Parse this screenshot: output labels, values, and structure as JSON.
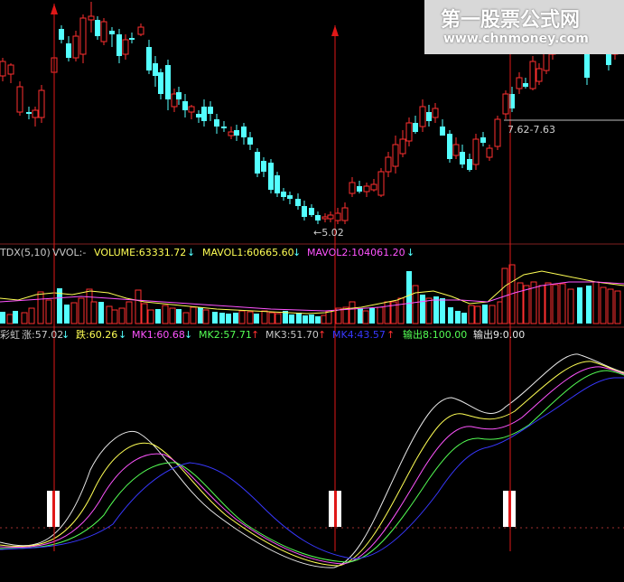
{
  "watermark": {
    "title": "第一股票公式网",
    "url": "www.chnmoney.com"
  },
  "price_panel": {
    "low_marker": "←5.02",
    "range_label": "7.62-7.63",
    "candles": [
      [
        3,
        84,
        68,
        90,
        64
      ],
      [
        12,
        82,
        72,
        92,
        70
      ],
      [
        22,
        124,
        96,
        128,
        90
      ],
      [
        32,
        124,
        124,
        132,
        118
      ],
      [
        39,
        130,
        122,
        140,
        118
      ],
      [
        46,
        130,
        100,
        136,
        94
      ],
      [
        60,
        80,
        64,
        86,
        56
      ],
      [
        68,
        32,
        44,
        48,
        28
      ],
      [
        76,
        48,
        64,
        68,
        40
      ],
      [
        84,
        64,
        40,
        68,
        34
      ],
      [
        92,
        60,
        20,
        70,
        16
      ],
      [
        101,
        22,
        18,
        36,
        2
      ],
      [
        108,
        22,
        40,
        44,
        18
      ],
      [
        115,
        46,
        24,
        50,
        20
      ],
      [
        124,
        34,
        38,
        52,
        30
      ],
      [
        132,
        38,
        62,
        70,
        32
      ],
      [
        139,
        60,
        44,
        66,
        38
      ],
      [
        146,
        42,
        42,
        48,
        36
      ],
      [
        156,
        38,
        30,
        40,
        26
      ],
      [
        165,
        52,
        78,
        82,
        44
      ],
      [
        172,
        70,
        84,
        96,
        62
      ],
      [
        178,
        80,
        104,
        110,
        76
      ],
      [
        186,
        72,
        110,
        122,
        66
      ],
      [
        193,
        118,
        104,
        124,
        98
      ],
      [
        198,
        102,
        110,
        116,
        96
      ],
      [
        205,
        112,
        122,
        130,
        104
      ],
      [
        212,
        124,
        118,
        132,
        116
      ],
      [
        220,
        126,
        130,
        136,
        122
      ],
      [
        226,
        118,
        134,
        140,
        110
      ],
      [
        233,
        118,
        126,
        134,
        112
      ],
      [
        240,
        132,
        140,
        148,
        126
      ],
      [
        248,
        140,
        140,
        146,
        134
      ],
      [
        256,
        150,
        146,
        154,
        140
      ],
      [
        262,
        144,
        150,
        156,
        138
      ],
      [
        270,
        140,
        152,
        160,
        136
      ],
      [
        277,
        152,
        160,
        166,
        146
      ],
      [
        285,
        168,
        192,
        196,
        164
      ],
      [
        292,
        178,
        190,
        196,
        174
      ],
      [
        300,
        180,
        210,
        214,
        176
      ],
      [
        307,
        194,
        214,
        218,
        190
      ],
      [
        314,
        212,
        218,
        222,
        208
      ],
      [
        321,
        216,
        220,
        226,
        212
      ],
      [
        330,
        220,
        228,
        232,
        214
      ],
      [
        337,
        228,
        240,
        244,
        222
      ],
      [
        345,
        230,
        238,
        240,
        226
      ],
      [
        352,
        238,
        244,
        248,
        234
      ],
      [
        360,
        242,
        240,
        246,
        236
      ],
      [
        366,
        242,
        238,
        246,
        234
      ],
      [
        374,
        244,
        236,
        248,
        230
      ],
      [
        382,
        244,
        230,
        248,
        224
      ],
      [
        390,
        214,
        202,
        218,
        196
      ],
      [
        398,
        206,
        212,
        214,
        200
      ],
      [
        406,
        212,
        206,
        218,
        202
      ],
      [
        414,
        210,
        204,
        212,
        198
      ],
      [
        422,
        216,
        190,
        218,
        186
      ],
      [
        430,
        190,
        174,
        196,
        168
      ],
      [
        438,
        184,
        160,
        192,
        150
      ],
      [
        446,
        170,
        154,
        174,
        144
      ],
      [
        453,
        156,
        136,
        162,
        130
      ],
      [
        460,
        136,
        146,
        148,
        128
      ],
      [
        468,
        140,
        118,
        146,
        110
      ],
      [
        475,
        124,
        134,
        140,
        116
      ],
      [
        482,
        130,
        120,
        136,
        114
      ],
      [
        490,
        140,
        150,
        150,
        132
      ],
      [
        498,
        148,
        176,
        180,
        144
      ],
      [
        505,
        172,
        160,
        176,
        152
      ],
      [
        512,
        168,
        182,
        186,
        160
      ],
      [
        520,
        176,
        188,
        190,
        170
      ],
      [
        527,
        182,
        154,
        188,
        148
      ],
      [
        535,
        152,
        158,
        162,
        146
      ],
      [
        542,
        174,
        164,
        178,
        160
      ],
      [
        551,
        162,
        132,
        166,
        128
      ],
      [
        560,
        126,
        104,
        132,
        100
      ],
      [
        567,
        104,
        120,
        124,
        96
      ],
      [
        575,
        98,
        86,
        104,
        80
      ],
      [
        582,
        92,
        96,
        98,
        86
      ],
      [
        590,
        98,
        68,
        100,
        62
      ],
      [
        597,
        90,
        76,
        94,
        70
      ],
      [
        605,
        78,
        58,
        82,
        52
      ],
      [
        612,
        60,
        52,
        66,
        46
      ],
      [
        622,
        50,
        44,
        56,
        40
      ],
      [
        630,
        42,
        50,
        52,
        36
      ],
      [
        640,
        46,
        38,
        52,
        32
      ],
      [
        650,
        60,
        86,
        94,
        52
      ],
      [
        658,
        54,
        48,
        58,
        44
      ],
      [
        666,
        50,
        44,
        56,
        40
      ],
      [
        674,
        50,
        72,
        78,
        44
      ],
      [
        681,
        60,
        50,
        66,
        46
      ]
    ]
  },
  "volume_panel": {
    "label_tdx": "TDX(5,10)",
    "label_vvol": "VVOL:-",
    "label_volume": "VOLUME:63331.72",
    "label_mavol1": "MAVOL1:60665.60",
    "label_mavol2": "MAVOL2:104061.20",
    "bars": [
      [
        3,
        345,
        0
      ],
      [
        11,
        348,
        1
      ],
      [
        17,
        344,
        0
      ],
      [
        27,
        346,
        1
      ],
      [
        35,
        341,
        1
      ],
      [
        45,
        323,
        1
      ],
      [
        54,
        332,
        1
      ],
      [
        66,
        319,
        0
      ],
      [
        74,
        337,
        0
      ],
      [
        82,
        335,
        1
      ],
      [
        90,
        330,
        1
      ],
      [
        99,
        320,
        1
      ],
      [
        104,
        334,
        1
      ],
      [
        112,
        334,
        0
      ],
      [
        121,
        339,
        1
      ],
      [
        127,
        343,
        1
      ],
      [
        135,
        341,
        1
      ],
      [
        143,
        334,
        1
      ],
      [
        153,
        321,
        1
      ],
      [
        160,
        336,
        1
      ],
      [
        167,
        343,
        1
      ],
      [
        175,
        342,
        0
      ],
      [
        183,
        338,
        1
      ],
      [
        191,
        341,
        1
      ],
      [
        198,
        342,
        0
      ],
      [
        206,
        346,
        1
      ],
      [
        214,
        340,
        1
      ],
      [
        222,
        340,
        0
      ],
      [
        228,
        343,
        1
      ],
      [
        238,
        345,
        0
      ],
      [
        246,
        346,
        0
      ],
      [
        253,
        347,
        0
      ],
      [
        261,
        346,
        0
      ],
      [
        268,
        344,
        1
      ],
      [
        277,
        345,
        1
      ],
      [
        284,
        347,
        0
      ],
      [
        293,
        344,
        1
      ],
      [
        301,
        346,
        1
      ],
      [
        308,
        347,
        1
      ],
      [
        316,
        344,
        0
      ],
      [
        323,
        348,
        0
      ],
      [
        331,
        346,
        0
      ],
      [
        338,
        349,
        0
      ],
      [
        345,
        348,
        0
      ],
      [
        352,
        350,
        0
      ],
      [
        359,
        349,
        1
      ],
      [
        364,
        345,
        1
      ],
      [
        375,
        341,
        1
      ],
      [
        383,
        340,
        1
      ],
      [
        390,
        334,
        1
      ],
      [
        399,
        341,
        0
      ],
      [
        405,
        344,
        1
      ],
      [
        412,
        341,
        0
      ],
      [
        421,
        340,
        1
      ],
      [
        429,
        334,
        1
      ],
      [
        436,
        334,
        1
      ],
      [
        444,
        330,
        1
      ],
      [
        453,
        300,
        0
      ],
      [
        460,
        316,
        1
      ],
      [
        468,
        326,
        0
      ],
      [
        475,
        330,
        1
      ],
      [
        483,
        328,
        0
      ],
      [
        490,
        330,
        0
      ],
      [
        499,
        340,
        0
      ],
      [
        507,
        344,
        0
      ],
      [
        514,
        346,
        0
      ],
      [
        522,
        338,
        1
      ],
      [
        529,
        339,
        1
      ],
      [
        537,
        337,
        0
      ],
      [
        545,
        338,
        1
      ],
      [
        554,
        334,
        1
      ],
      [
        559,
        297,
        1
      ],
      [
        567,
        293,
        1
      ],
      [
        576,
        313,
        1
      ],
      [
        583,
        316,
        1
      ],
      [
        591,
        312,
        1
      ],
      [
        600,
        316,
        1
      ],
      [
        607,
        313,
        1
      ],
      [
        615,
        315,
        1
      ],
      [
        623,
        314,
        1
      ],
      [
        632,
        320,
        1
      ],
      [
        642,
        318,
        0
      ],
      [
        652,
        316,
        0
      ],
      [
        660,
        312,
        1
      ],
      [
        668,
        318,
        1
      ],
      [
        676,
        320,
        1
      ],
      [
        684,
        322,
        1
      ]
    ]
  },
  "indicator_panel": {
    "label_name": "彩虹",
    "label_up": "涨:57.02",
    "label_down": "跌:60.26",
    "label_mk1": "MK1:60.68",
    "label_mk2": "MK2:57.71",
    "label_mk3": "MK3:51.70",
    "label_mk4": "MK4:43.57",
    "label_out8": "输出8:100.00",
    "label_out9": "输出9:0.00"
  },
  "colors": {
    "up": "#ff3030",
    "down": "#54ffff",
    "white": "#e8e8e8",
    "yellow": "#ffff54",
    "magenta": "#ff54ff",
    "green": "#54ff54",
    "blue": "#3030ff",
    "grid": "#802020"
  }
}
